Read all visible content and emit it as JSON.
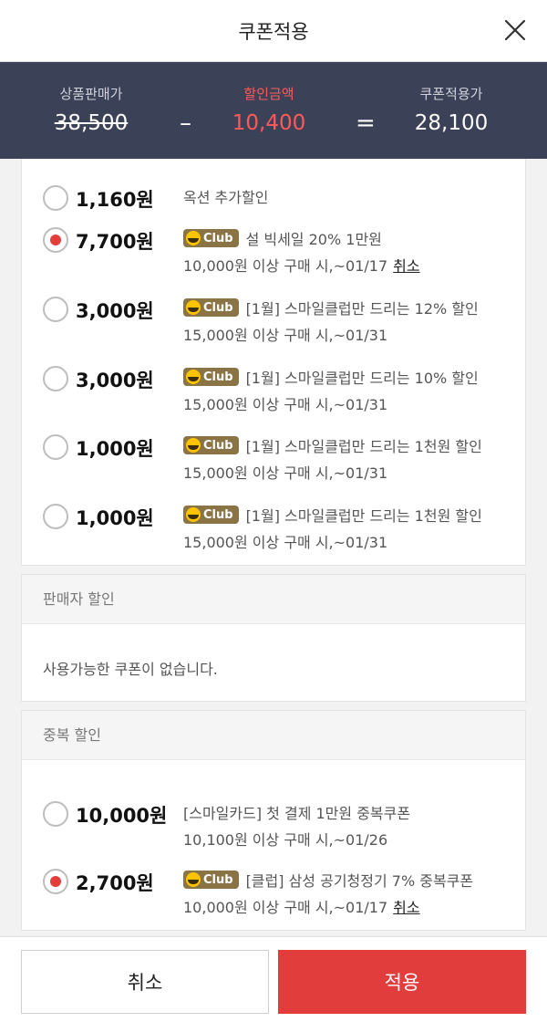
{
  "header": {
    "title": "쿠폰적용"
  },
  "summary": {
    "price_label": "상품판매가",
    "price_value": "38,500",
    "discount_label": "할인금액",
    "discount_value": "10,400",
    "final_label": "쿠폰적용가",
    "final_value": "28,100",
    "minus": "–",
    "equals": "="
  },
  "badge_label": "Club",
  "cancel_link": "취소",
  "product_coupons": [
    {
      "amount": "1,160원",
      "selected": false,
      "title": "옥션 추가할인",
      "badge": false,
      "condition": ""
    },
    {
      "amount": "7,700원",
      "selected": true,
      "title": "설 빅세일 20% 1만원",
      "badge": true,
      "condition": "10,000원 이상 구매 시,~01/17"
    },
    {
      "amount": "3,000원",
      "selected": false,
      "title": "[1월] 스마일클럽만 드리는 12% 할인",
      "badge": true,
      "condition": "15,000원 이상 구매 시,~01/31"
    },
    {
      "amount": "3,000원",
      "selected": false,
      "title": "[1월] 스마일클럽만 드리는 10% 할인",
      "badge": true,
      "condition": "15,000원 이상 구매 시,~01/31"
    },
    {
      "amount": "1,000원",
      "selected": false,
      "title": "[1월] 스마일클럽만 드리는 1천원 할인",
      "badge": true,
      "condition": "15,000원 이상 구매 시,~01/31"
    },
    {
      "amount": "1,000원",
      "selected": false,
      "title": "[1월] 스마일클럽만 드리는 1천원 할인",
      "badge": true,
      "condition": "15,000원 이상 구매 시,~01/31"
    }
  ],
  "seller_section": {
    "title": "판매자 할인",
    "empty_message": "사용가능한 쿠폰이 없습니다."
  },
  "duplicate_section": {
    "title": "중복 할인",
    "coupons": [
      {
        "amount": "10,000원",
        "selected": false,
        "title": "[스마일카드] 첫 결제 1만원 중복쿠폰",
        "badge": false,
        "condition": "10,100원 이상 구매 시,~01/26"
      },
      {
        "amount": "2,700원",
        "selected": true,
        "title": "[클럽] 삼성 공기청정기 7% 중복쿠폰",
        "badge": true,
        "condition": "10,000원 이상 구매 시,~01/17"
      }
    ]
  },
  "footer": {
    "cancel_label": "취소",
    "apply_label": "적용"
  },
  "colors": {
    "accent": "#e23d3d",
    "summary_bg": "#3b4157",
    "badge_bg": "#8a7446"
  }
}
